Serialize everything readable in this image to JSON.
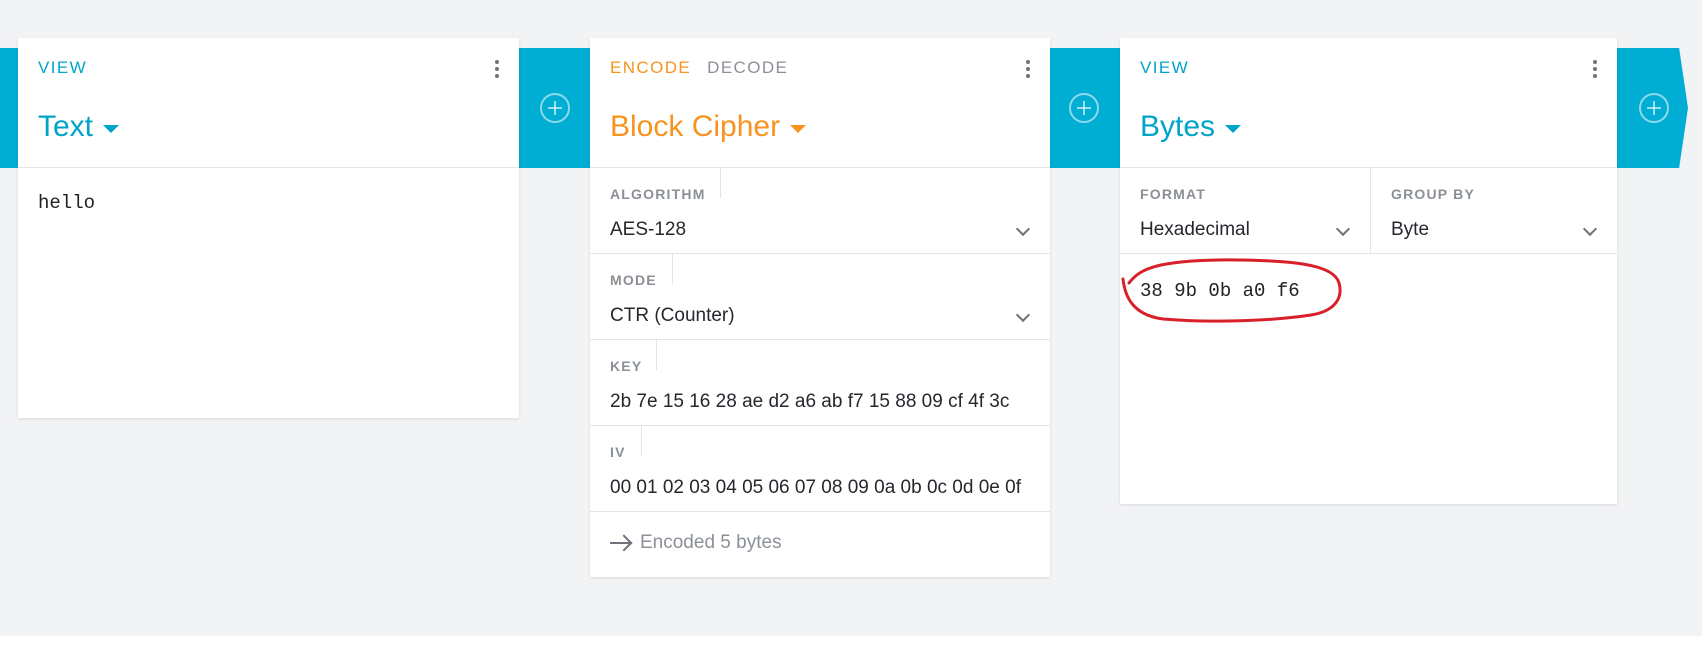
{
  "left_card": {
    "tab": "VIEW",
    "title": "Text",
    "content": "hello"
  },
  "middle_card": {
    "tab_encode": "ENCODE",
    "tab_decode": "DECODE",
    "title": "Block Cipher",
    "fields": [
      {
        "label": "ALGORITHM",
        "value": "AES-128",
        "type": "select"
      },
      {
        "label": "MODE",
        "value": "CTR (Counter)",
        "type": "select"
      },
      {
        "label": "KEY",
        "value": "2b 7e 15 16 28 ae d2 a6 ab f7 15 88 09 cf 4f 3c",
        "type": "text"
      },
      {
        "label": "IV",
        "value": "00 01 02 03 04 05 06 07 08 09 0a 0b 0c 0d 0e 0f",
        "type": "text"
      }
    ],
    "status": "Encoded 5 bytes"
  },
  "right_card": {
    "tab": "VIEW",
    "title": "Bytes",
    "format_label": "FORMAT",
    "format_value": "Hexadecimal",
    "group_label": "GROUP BY",
    "group_value": "Byte",
    "content": "38 9b 0b a0 f6"
  },
  "colors": {
    "accent_blue": "#00a4c9",
    "band_blue": "#00aed3",
    "accent_orange": "#f7931e",
    "annotation_red": "#d9202a"
  },
  "icons": [
    "plus-circle-icon",
    "more-vert-icon",
    "dropdown-caret-icon",
    "chevron-down-icon",
    "arrow-right-icon"
  ]
}
